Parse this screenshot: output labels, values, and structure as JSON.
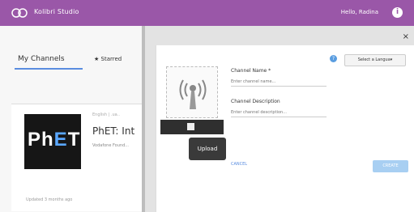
{
  "topbar": {
    "app_title": "Kolibri Studio",
    "greeting": "Hello, Radina",
    "info_icon": "i",
    "logo_icon": "kolibri-logo-icon",
    "bg_color": "#9a57a8"
  },
  "tabs": {
    "my_channels": "My Channels",
    "starred": "Starred",
    "starred_icon": "star-icon"
  },
  "card": {
    "language": "English | .ua..",
    "title": "PhET: Int",
    "owner": "Vodafone Found...",
    "updated": "Updated 3 months ago",
    "thumb_text_ph": "Ph",
    "thumb_text_e": "E",
    "thumb_text_t": "T"
  },
  "modal": {
    "close": "×",
    "help": "?",
    "language_select": "Select a Langua▾",
    "channel_name_label": "Channel Name *",
    "channel_name_placeholder": "Enter channel name...",
    "channel_description_label": "Channel Description",
    "channel_description_placeholder": "Enter channel description...",
    "upload_tooltip": "Upload",
    "cancel": "CANCEL",
    "create": "CREATE"
  }
}
